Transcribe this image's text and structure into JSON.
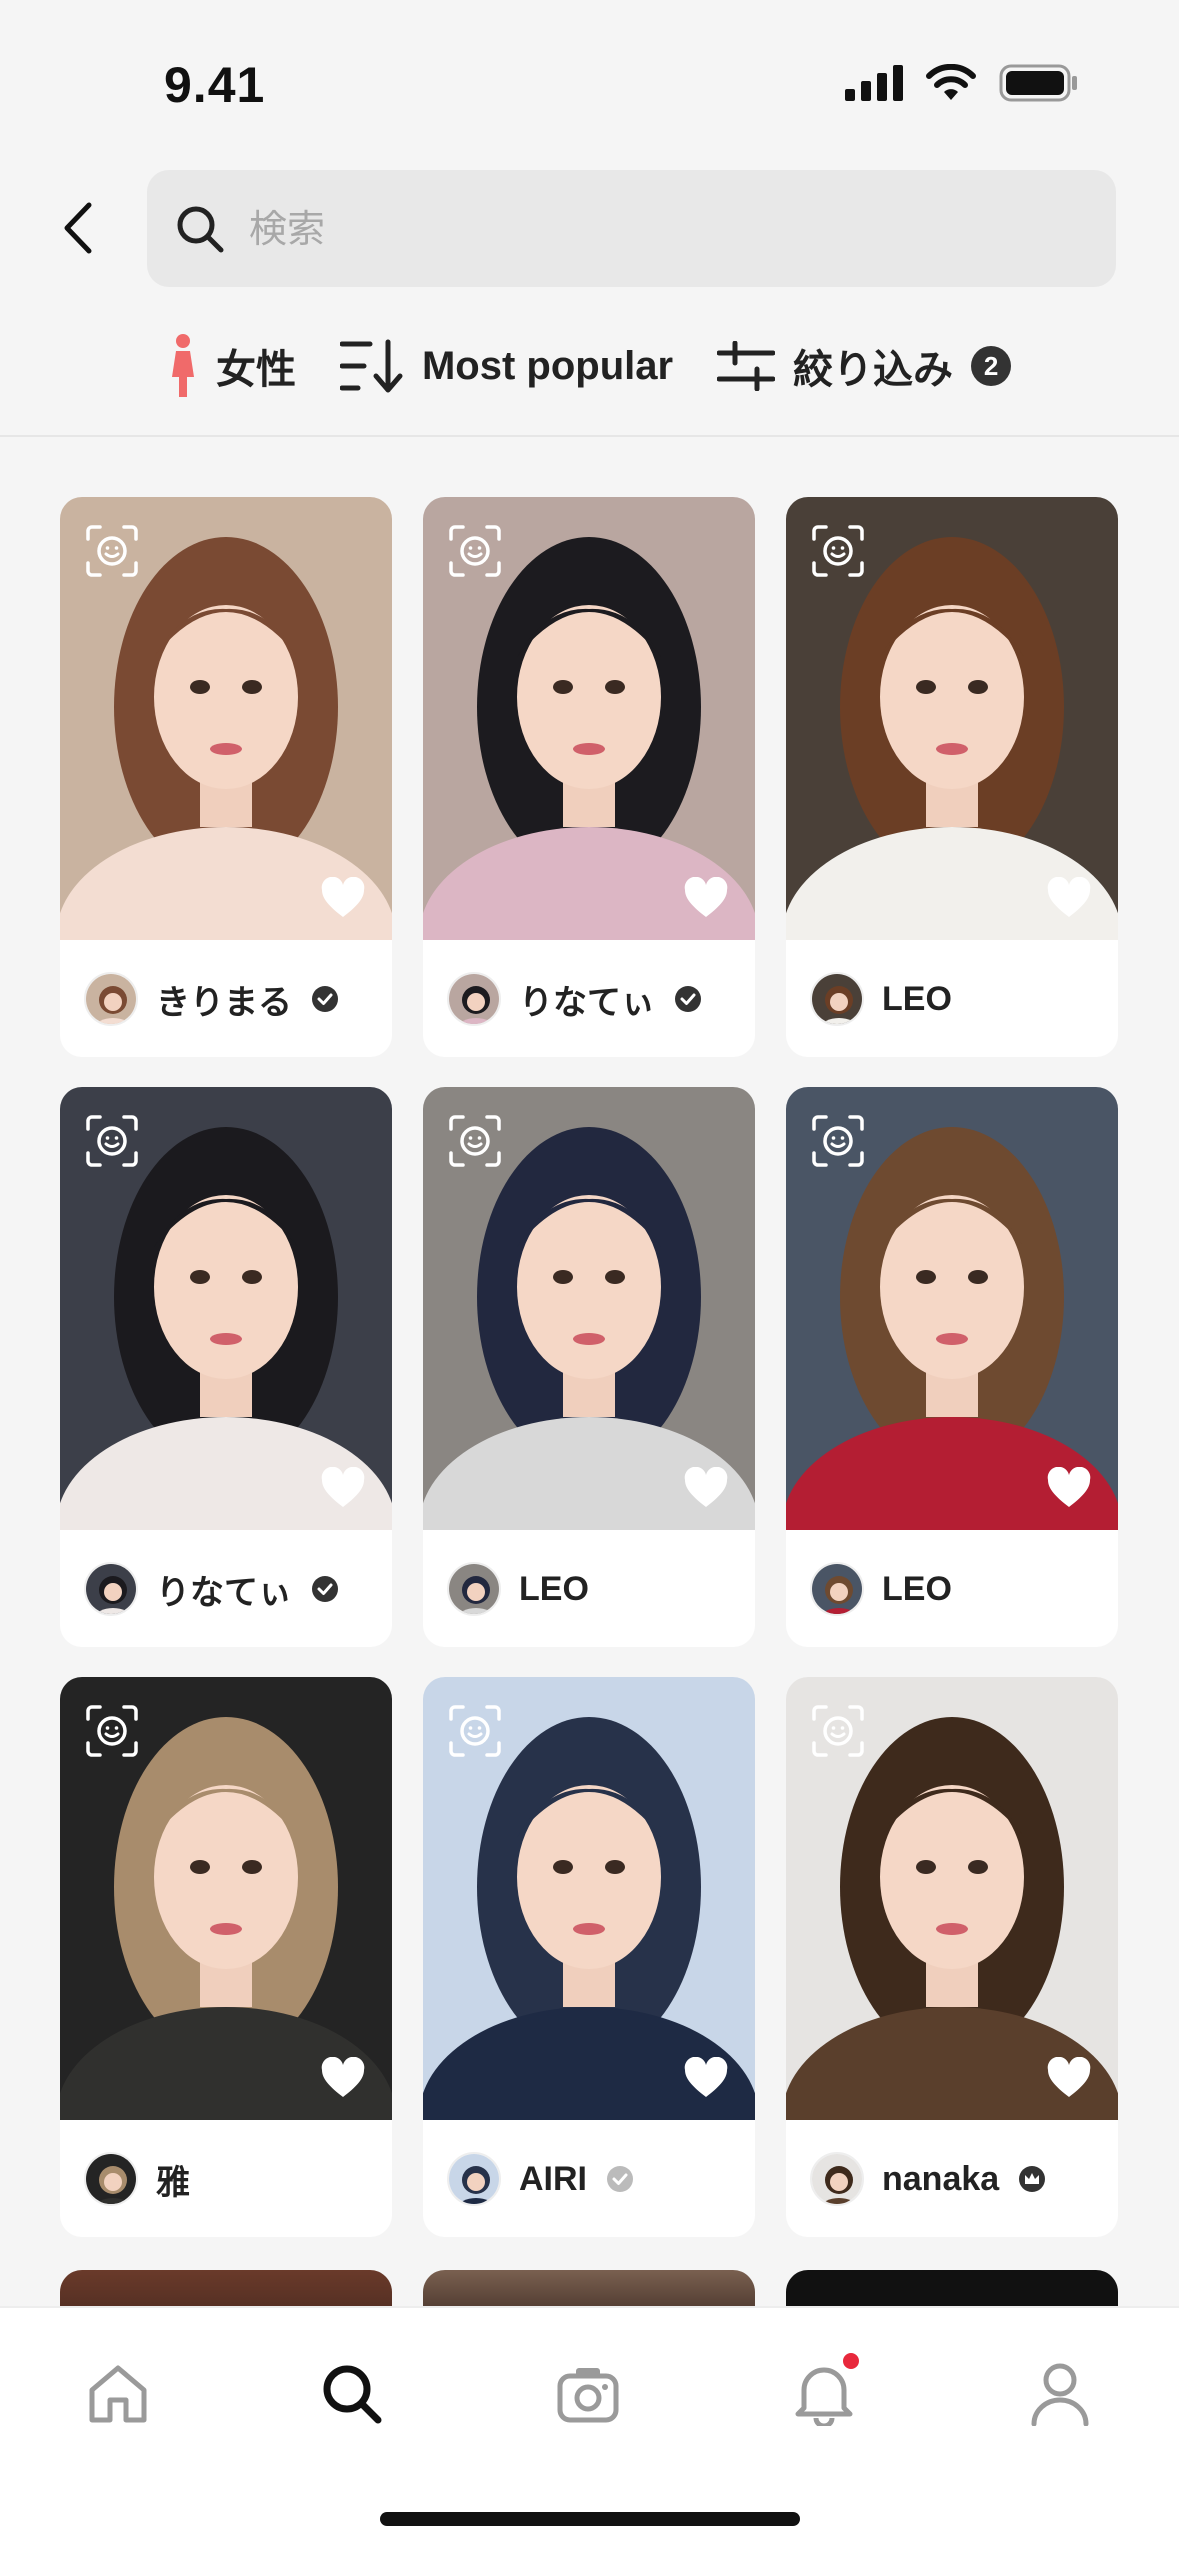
{
  "status_bar": {
    "time": "9.41"
  },
  "search": {
    "placeholder": "検索"
  },
  "filters": {
    "gender_label": "女性",
    "sort_label": "Most popular",
    "refine_label": "絞り込み",
    "refine_count": "2"
  },
  "cards": [
    {
      "username": "きりまる",
      "verified": true,
      "badge_icon": "verified-icon",
      "photo_tone": [
        "#c9b3a0",
        "#7a4a33",
        "#f3ddd2"
      ]
    },
    {
      "username": "りなてぃ",
      "verified": true,
      "badge_icon": "verified-icon",
      "photo_tone": [
        "#b9a6a0",
        "#1c1b1f",
        "#dcb6c4"
      ]
    },
    {
      "username": "LEO",
      "verified": false,
      "badge_icon": "",
      "photo_tone": [
        "#4a4038",
        "#6b3e25",
        "#f2f0ec"
      ]
    },
    {
      "username": "りなてぃ",
      "verified": true,
      "badge_icon": "verified-icon",
      "photo_tone": [
        "#3c3f49",
        "#1b1a1e",
        "#eee8e6"
      ]
    },
    {
      "username": "LEO",
      "verified": false,
      "badge_icon": "",
      "photo_tone": [
        "#8a8682",
        "#22283f",
        "#d8d8d8"
      ]
    },
    {
      "username": "LEO",
      "verified": false,
      "badge_icon": "",
      "photo_tone": [
        "#4a5565",
        "#6e4a30",
        "#b41e33"
      ]
    },
    {
      "username": "雅",
      "verified": false,
      "badge_icon": "",
      "photo_tone": [
        "#242424",
        "#a88c6c",
        "#30302e"
      ]
    },
    {
      "username": "AIRI",
      "verified": true,
      "badge_icon": "verified-grey-icon",
      "photo_tone": [
        "#c8d6e8",
        "#27324a",
        "#1e2a44"
      ]
    },
    {
      "username": "nanaka",
      "verified": true,
      "badge_icon": "crown-badge-icon",
      "photo_tone": [
        "#e6e4e2",
        "#3e2a1c",
        "#5a3f2c"
      ]
    }
  ],
  "tabs": [
    "home-icon",
    "search-icon",
    "camera-icon",
    "bell-icon",
    "profile-icon"
  ],
  "colors": {
    "accent": "#e8283c",
    "gender_icon": "#f06a6a"
  }
}
